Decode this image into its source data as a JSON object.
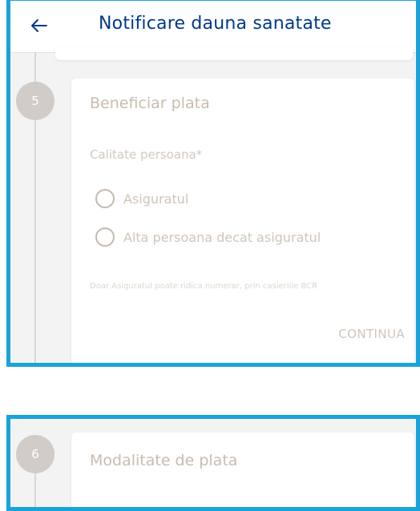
{
  "header": {
    "title": "Notificare dauna sanatate",
    "back_icon": "arrow-left-icon"
  },
  "step5": {
    "number": "5",
    "title": "Beneficiar plata",
    "field_label": "Calitate persoana*",
    "options": [
      "Asiguratul",
      "Alta persoana decat asiguratul"
    ],
    "selected": null,
    "hint": "Doar Asiguratul poate ridica numerar, prin casieriile BCR",
    "continue_label": "CONTINUA"
  },
  "step6": {
    "number": "6",
    "title": "Modalitate de plata"
  },
  "colors": {
    "highlight_border": "#1aa3da",
    "title_blue": "#00398a",
    "step_circle": "#d1ccc7"
  }
}
